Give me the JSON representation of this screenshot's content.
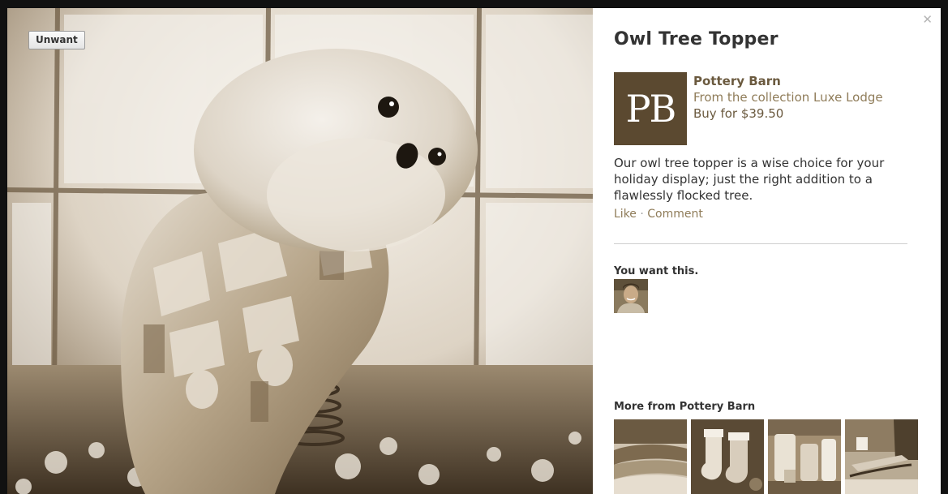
{
  "photo": {
    "unwant_label": "Unwant"
  },
  "panel": {
    "close_icon": "close-icon",
    "title": "Owl Tree Topper",
    "brand": {
      "logo_text": "PB",
      "name": "Pottery Barn",
      "collection": "From the collection Luxe Lodge",
      "price": "Buy for $39.50"
    },
    "description": "Our owl tree topper is a wise choice for your holiday display; just the right addition to a flawlessly flocked tree.",
    "actions": {
      "like": "Like",
      "separator": "·",
      "comment": "Comment"
    },
    "want_label": "You want this.",
    "more_label": "More from Pottery Barn"
  },
  "colors": {
    "brand_brown": "#5b4930",
    "link_brown": "#8f7c59",
    "sepia_dark": "#4a3a26",
    "sepia_light": "#e9e2d6"
  }
}
